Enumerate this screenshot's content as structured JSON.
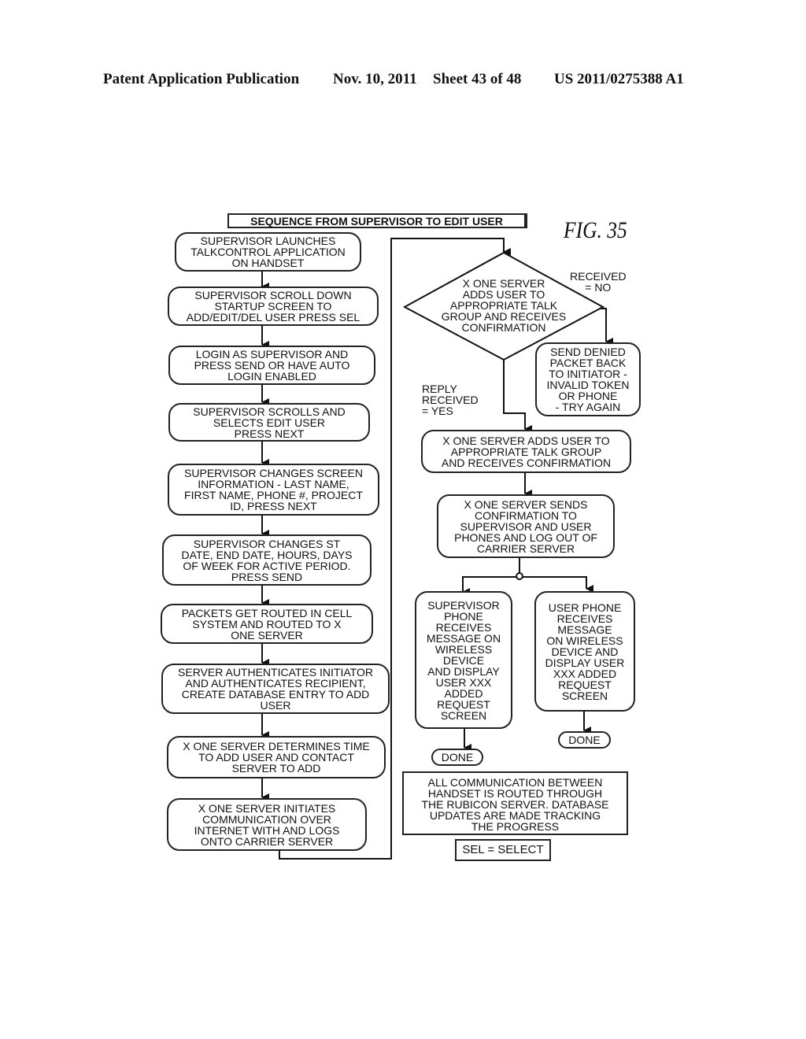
{
  "header": {
    "publication": "Patent Application Publication",
    "date": "Nov. 10, 2011",
    "sheet": "Sheet 43 of 48",
    "number": "US 2011/0275388 A1"
  },
  "figure": {
    "label": "FIG. 35",
    "title": "SEQUENCE FROM SUPERVISOR TO EDIT USER"
  },
  "left_column": [
    "SUPERVISOR LAUNCHES\nTALKCONTROL APPLICATION\nON HANDSET",
    "SUPERVISOR SCROLL DOWN\nSTARTUP SCREEN TO\nADD/EDIT/DEL USER PRESS SEL",
    "LOGIN AS SUPERVISOR AND\nPRESS SEND OR HAVE AUTO\nLOGIN ENABLED",
    "SUPERVISOR SCROLLS AND\nSELECTS EDIT USER\nPRESS NEXT",
    "SUPERVISOR CHANGES SCREEN\nINFORMATION - LAST NAME,\nFIRST NAME, PHONE #, PROJECT\nID, PRESS NEXT",
    "SUPERVISOR CHANGES ST\nDATE, END DATE, HOURS, DAYS\nOF WEEK FOR ACTIVE PERIOD.\nPRESS SEND",
    "PACKETS GET ROUTED IN CELL\nSYSTEM AND ROUTED TO X\nONE SERVER",
    "SERVER AUTHENTICATES INITIATOR\nAND AUTHENTICATES RECIPIENT,\nCREATE DATABASE ENTRY TO ADD\nUSER",
    "X ONE SERVER DETERMINES TIME\nTO ADD USER AND CONTACT\nSERVER TO ADD",
    "X ONE SERVER INITIATES\nCOMMUNICATION OVER\nINTERNET WITH AND LOGS\nONTO CARRIER SERVER"
  ],
  "decision": {
    "text": "X ONE SERVER\nADDS USER TO\nAPPROPRIATE TALK\nGROUP AND RECEIVES\nCONFIRMATION",
    "no_label": "RECEIVED\n= NO",
    "yes_label": "REPLY\nRECEIVED\n= YES"
  },
  "denied": "SEND DENIED\nPACKET BACK\nTO INITIATOR -\nINVALID TOKEN\nOR PHONE\n- TRY AGAIN",
  "right_column": {
    "adds_user": "X ONE SERVER ADDS USER TO\nAPPROPRIATE TALK GROUP\nAND RECEIVES CONFIRMATION",
    "sends_confirmation": "X ONE SERVER SENDS\nCONFIRMATION TO\nSUPERVISOR AND USER\nPHONES AND LOG OUT OF\nCARRIER SERVER",
    "supervisor_phone": "SUPERVISOR\nPHONE\nRECEIVES\nMESSAGE ON\nWIRELESS\nDEVICE\nAND DISPLAY\nUSER XXX\nADDED\nREQUEST\nSCREEN",
    "user_phone": "USER PHONE\nRECEIVES\nMESSAGE\nON WIRELESS\nDEVICE AND\nDISPLAY USER\nXXX ADDED\nREQUEST\nSCREEN",
    "done_left": "DONE",
    "done_right": "DONE"
  },
  "notes": {
    "communication": "ALL COMMUNICATION BETWEEN\nHANDSET IS ROUTED THROUGH\nTHE RUBICON SERVER.  DATABASE\nUPDATES ARE MADE TRACKING\nTHE PROGRESS",
    "legend": "SEL = SELECT"
  }
}
